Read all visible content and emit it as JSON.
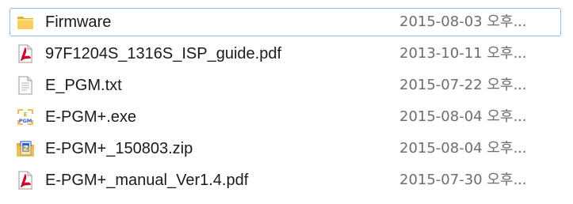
{
  "files": [
    {
      "name": "Firmware",
      "date": "2015-08-03 오후...",
      "icon": "folder-icon"
    },
    {
      "name": "97F1204S_1316S_ISP_guide.pdf",
      "date": "2013-10-11 오후...",
      "icon": "pdf-icon"
    },
    {
      "name": "E_PGM.txt",
      "date": "2015-07-22 오후...",
      "icon": "text-file-icon"
    },
    {
      "name": "E-PGM+.exe",
      "date": "2015-08-04 오후...",
      "icon": "exe-pgm-icon"
    },
    {
      "name": "E-PGM+_150803.zip",
      "date": "2015-08-04 오후...",
      "icon": "zip-icon"
    },
    {
      "name": "E-PGM+_manual_Ver1.4.pdf",
      "date": "2015-07-30 오후...",
      "icon": "pdf-icon"
    }
  ],
  "colors": {
    "selection_border": "#8fbbe8",
    "name_text": "#1a1a1a",
    "date_text": "#6d6d6d",
    "folder": "#f2c24c",
    "pdf": "#c8102e"
  }
}
